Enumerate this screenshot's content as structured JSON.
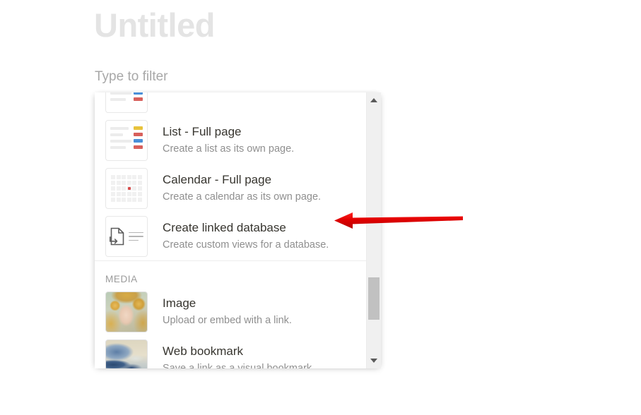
{
  "page": {
    "title": "Untitled",
    "filter_placeholder": "Type to filter"
  },
  "colors": {
    "title_gray": "#e4e4e4",
    "placeholder_gray": "#a8a8a8",
    "item_title": "#37352f",
    "item_desc": "#8f8f8f",
    "section_header": "#9b9b9b",
    "annotation_red": "#e60000",
    "scrollbar_thumb": "#c1c1c1",
    "scrollbar_track": "#f0f0f0",
    "calendar_dot_red": "#d94b4b",
    "list_tag_yellow": "#e8c33c",
    "list_tag_red": "#d8605c",
    "list_tag_blue": "#4a90d9"
  },
  "block_menu": {
    "sections": [
      {
        "header": null,
        "items": [
          {
            "title": "List - Full page",
            "description": "Create a list as its own page.",
            "icon": "list-fullpage-icon"
          },
          {
            "title": "Calendar - Full page",
            "description": "Create a calendar as its own page.",
            "icon": "calendar-fullpage-icon"
          },
          {
            "title": "Create linked database",
            "description": "Create custom views for a database.",
            "icon": "linked-database-icon"
          }
        ]
      },
      {
        "header": "MEDIA",
        "items": [
          {
            "title": "Image",
            "description": "Upload or embed with a link.",
            "icon": "image-thumbnail-icon"
          },
          {
            "title": "Web bookmark",
            "description": "Save a link as a visual bookmark.",
            "icon": "web-bookmark-thumbnail-icon"
          }
        ]
      }
    ],
    "scrollbar": {
      "up_arrow": "scroll-up-arrow-icon",
      "down_arrow": "scroll-down-arrow-icon"
    }
  },
  "annotation": {
    "type": "arrow-left",
    "points_to": "Create linked database",
    "color": "#e60000"
  }
}
